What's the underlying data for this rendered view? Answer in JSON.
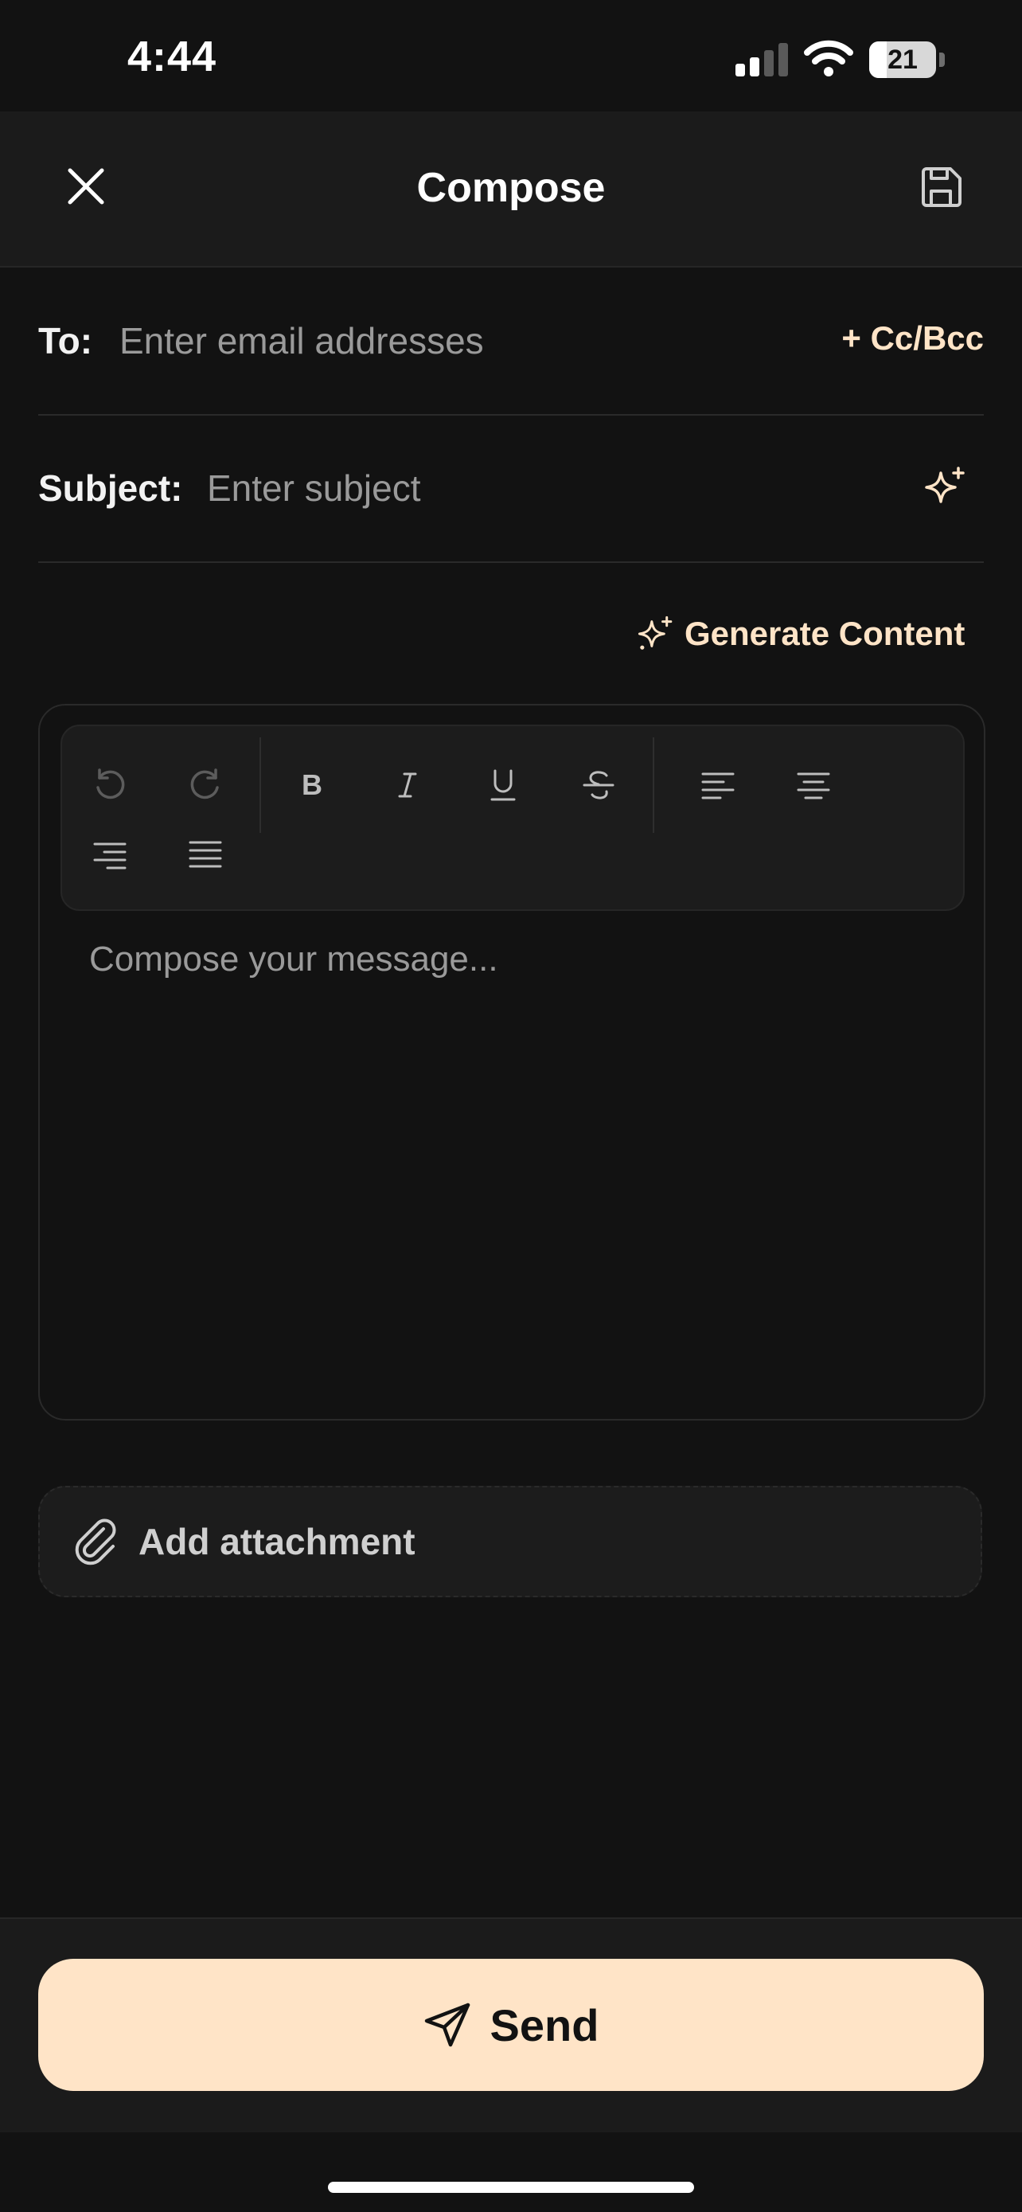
{
  "status_bar": {
    "time": "4:44",
    "battery": "21",
    "icons": [
      "cellular-signal-icon",
      "wifi-icon",
      "battery-icon"
    ]
  },
  "header": {
    "title": "Compose",
    "close_icon": "close-icon",
    "save_icon": "save-icon"
  },
  "to_field": {
    "label": "To:",
    "placeholder": "Enter email addresses",
    "value": "",
    "cc_bcc_label": "+ Cc/Bcc"
  },
  "subject_field": {
    "label": "Subject:",
    "placeholder": "Enter subject",
    "value": "",
    "ai_icon": "sparkle-icon"
  },
  "generate": {
    "label": "Generate Content",
    "icon": "sparkle-icon"
  },
  "editor": {
    "toolbar": [
      "undo-icon",
      "redo-icon",
      "bold-icon",
      "italic-icon",
      "underline-icon",
      "strikethrough-icon",
      "align-left-icon",
      "align-center-icon",
      "align-right-icon",
      "align-justify-icon"
    ],
    "placeholder": "Compose your message...",
    "value": ""
  },
  "attachment": {
    "label": "Add attachment",
    "icon": "paperclip-icon"
  },
  "send": {
    "label": "Send",
    "icon": "send-icon"
  },
  "colors": {
    "background": "#121212",
    "surface": "#1b1b1b",
    "accent": "#ffe4c7",
    "placeholder": "#9a9a9a"
  }
}
